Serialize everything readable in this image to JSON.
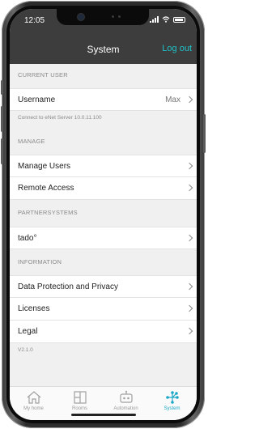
{
  "status_bar": {
    "time": "12:05"
  },
  "nav": {
    "title": "System",
    "logout": "Log out"
  },
  "sections": {
    "current_user": {
      "header": "CURRENT USER",
      "username_label": "Username",
      "username_value": "Max",
      "connection_note": "Connect to eNet Server 10.0.11.100"
    },
    "manage": {
      "header": "MANAGE",
      "items": [
        "Manage Users",
        "Remote Access"
      ]
    },
    "partnersystems": {
      "header": "PARTNERSYSTEMS",
      "items": [
        "tado°"
      ]
    },
    "information": {
      "header": "INFORMATION",
      "items": [
        "Data Protection and Privacy",
        "Licenses",
        "Legal"
      ],
      "version": "V2.1.0"
    }
  },
  "tabs": [
    {
      "label": "My home",
      "icon": "house-icon",
      "active": false
    },
    {
      "label": "Rooms",
      "icon": "rooms-icon",
      "active": false
    },
    {
      "label": "Automation",
      "icon": "robot-icon",
      "active": false
    },
    {
      "label": "System",
      "icon": "network-icon",
      "active": true
    }
  ],
  "colors": {
    "accent": "#1ec0c8",
    "bar": "#3d3d3d",
    "background": "#f0f0f0"
  }
}
